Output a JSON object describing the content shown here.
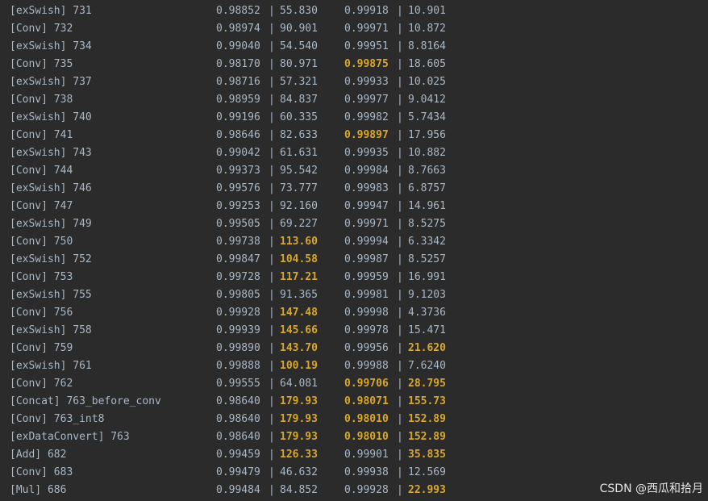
{
  "separator": "|",
  "highlight_color": "#d9a82a",
  "rows": [
    {
      "name": "[exSwish] 731",
      "c1": "0.98852",
      "c2": "55.830",
      "c3": "0.99918",
      "c4": "10.901",
      "hl": []
    },
    {
      "name": "[Conv] 732",
      "c1": "0.98974",
      "c2": "90.901",
      "c3": "0.99971",
      "c4": "10.872",
      "hl": []
    },
    {
      "name": "[exSwish] 734",
      "c1": "0.99040",
      "c2": "54.540",
      "c3": "0.99951",
      "c4": "8.8164",
      "hl": []
    },
    {
      "name": "[Conv] 735",
      "c1": "0.98170",
      "c2": "80.971",
      "c3": "0.99875",
      "c4": "18.605",
      "hl": [
        "c3"
      ]
    },
    {
      "name": "[exSwish] 737",
      "c1": "0.98716",
      "c2": "57.321",
      "c3": "0.99933",
      "c4": "10.025",
      "hl": []
    },
    {
      "name": "[Conv] 738",
      "c1": "0.98959",
      "c2": "84.837",
      "c3": "0.99977",
      "c4": "9.0412",
      "hl": []
    },
    {
      "name": "[exSwish] 740",
      "c1": "0.99196",
      "c2": "60.335",
      "c3": "0.99982",
      "c4": "5.7434",
      "hl": []
    },
    {
      "name": "[Conv] 741",
      "c1": "0.98646",
      "c2": "82.633",
      "c3": "0.99897",
      "c4": "17.956",
      "hl": [
        "c3"
      ]
    },
    {
      "name": "[exSwish] 743",
      "c1": "0.99042",
      "c2": "61.631",
      "c3": "0.99935",
      "c4": "10.882",
      "hl": []
    },
    {
      "name": "[Conv] 744",
      "c1": "0.99373",
      "c2": "95.542",
      "c3": "0.99984",
      "c4": "8.7663",
      "hl": []
    },
    {
      "name": "[exSwish] 746",
      "c1": "0.99576",
      "c2": "73.777",
      "c3": "0.99983",
      "c4": "6.8757",
      "hl": []
    },
    {
      "name": "[Conv] 747",
      "c1": "0.99253",
      "c2": "92.160",
      "c3": "0.99947",
      "c4": "14.961",
      "hl": []
    },
    {
      "name": "[exSwish] 749",
      "c1": "0.99505",
      "c2": "69.227",
      "c3": "0.99971",
      "c4": "8.5275",
      "hl": []
    },
    {
      "name": "[Conv] 750",
      "c1": "0.99738",
      "c2": "113.60",
      "c3": "0.99994",
      "c4": "6.3342",
      "hl": [
        "c2"
      ]
    },
    {
      "name": "[exSwish] 752",
      "c1": "0.99847",
      "c2": "104.58",
      "c3": "0.99987",
      "c4": "8.5257",
      "hl": [
        "c2"
      ]
    },
    {
      "name": "[Conv] 753",
      "c1": "0.99728",
      "c2": "117.21",
      "c3": "0.99959",
      "c4": "16.991",
      "hl": [
        "c2"
      ]
    },
    {
      "name": "[exSwish] 755",
      "c1": "0.99805",
      "c2": "91.365",
      "c3": "0.99981",
      "c4": "9.1203",
      "hl": []
    },
    {
      "name": "[Conv] 756",
      "c1": "0.99928",
      "c2": "147.48",
      "c3": "0.99998",
      "c4": "4.3736",
      "hl": [
        "c2"
      ]
    },
    {
      "name": "[exSwish] 758",
      "c1": "0.99939",
      "c2": "145.66",
      "c3": "0.99978",
      "c4": "15.471",
      "hl": [
        "c2"
      ]
    },
    {
      "name": "[Conv] 759",
      "c1": "0.99890",
      "c2": "143.70",
      "c3": "0.99956",
      "c4": "21.620",
      "hl": [
        "c2",
        "c4"
      ]
    },
    {
      "name": "[exSwish] 761",
      "c1": "0.99888",
      "c2": "100.19",
      "c3": "0.99988",
      "c4": "7.6240",
      "hl": [
        "c2"
      ]
    },
    {
      "name": "[Conv] 762",
      "c1": "0.99555",
      "c2": "64.081",
      "c3": "0.99706",
      "c4": "28.795",
      "hl": [
        "c3",
        "c4"
      ]
    },
    {
      "name": "[Concat] 763_before_conv",
      "c1": "0.98640",
      "c2": "179.93",
      "c3": "0.98071",
      "c4": "155.73",
      "hl": [
        "c2",
        "c3",
        "c4"
      ]
    },
    {
      "name": "[Conv] 763_int8",
      "c1": "0.98640",
      "c2": "179.93",
      "c3": "0.98010",
      "c4": "152.89",
      "hl": [
        "c2",
        "c3",
        "c4"
      ]
    },
    {
      "name": "[exDataConvert] 763",
      "c1": "0.98640",
      "c2": "179.93",
      "c3": "0.98010",
      "c4": "152.89",
      "hl": [
        "c2",
        "c3",
        "c4"
      ]
    },
    {
      "name": "[Add] 682",
      "c1": "0.99459",
      "c2": "126.33",
      "c3": "0.99901",
      "c4": "35.835",
      "hl": [
        "c2",
        "c4"
      ]
    },
    {
      "name": "[Conv] 683",
      "c1": "0.99479",
      "c2": "46.632",
      "c3": "0.99938",
      "c4": "12.569",
      "hl": []
    },
    {
      "name": "[Mul] 686",
      "c1": "0.99484",
      "c2": "84.852",
      "c3": "0.99928",
      "c4": "22.993",
      "hl": [
        "c4"
      ]
    }
  ],
  "watermark": "CSDN @西瓜和拾月"
}
